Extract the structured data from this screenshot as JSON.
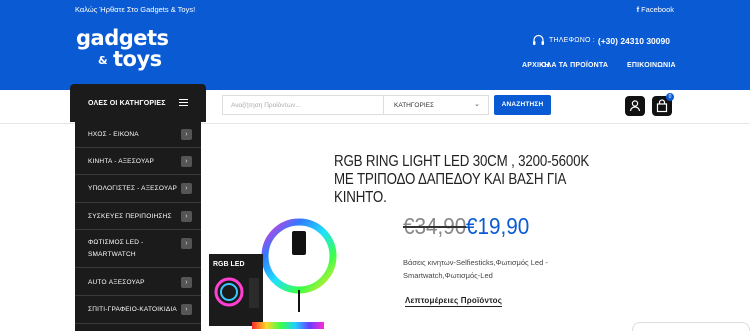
{
  "topbar": {
    "welcome": "Καλώς Ήρθατε Στο Gadgets & Toys!",
    "facebook": "Facebook",
    "facebook_icon": "facebook-icon"
  },
  "logo": {
    "line1": "gadgets",
    "amp": "&",
    "line2": "toys"
  },
  "contact": {
    "icon": "headset-icon",
    "label": "ΤΗΛΕΦΩΝΟ :",
    "phone": "(+30) 24310 30090"
  },
  "nav": [
    "ΑΡΧΙΚΗ",
    "ΟΛΑ ΤΑ ΠΡΟΪΟΝΤΑ",
    "ΕΠΙΚΟΙΝΩΝΙΑ"
  ],
  "categories_menu": {
    "title": "ΟΛΕΣ ΟΙ ΚΑΤΗΓΟΡΙΕΣ",
    "icon": "menu-icon"
  },
  "search": {
    "placeholder": "Αναζήτηση Προϊόντων...",
    "category": "ΚΑΤΗΓΟΡΙΕΣ",
    "button": "ΑΝΑΖΗΤΗΣΗ"
  },
  "cart": {
    "count": "0",
    "account_icon": "user-icon",
    "cart_icon": "shopping-bag-icon"
  },
  "sidebar": [
    {
      "label": "ΗΧΟΣ - ΕΙΚΟΝΑ"
    },
    {
      "label": "ΚΙΝΗΤΑ - ΑΞΕΣΟΥΑΡ"
    },
    {
      "label": "ΥΠΟΛΟΓΙΣΤΕΣ - ΑΞΕΣΟΥΑΡ"
    },
    {
      "label": "ΣΥΣΚΕΥΕΣ ΠΕΡΙΠΟΙΗΣΗΣ"
    },
    {
      "label": "ΦΩΤΙΣΜΟΣ LED -",
      "label2": "SMARTWATCH"
    },
    {
      "label": "AUTO ΑΞΕΣΟΥΑΡ"
    },
    {
      "label": "ΣΠΙΤΙ-ΓΡΑΦΕΙΟ-ΚΑΤΟΙΚΙΔΙΑ"
    }
  ],
  "product": {
    "title": "RGB RING LIGHT LED 30CM , 3200-5600K ΜΕ ΤΡΙΠΟΔΟ ΔΑΠΕΔΟΥ ΚΑΙ ΒΑΣΗ ΓΙΑ ΚΙΝΗΤΟ.",
    "old_price": "€34,90",
    "new_price": "€19,90",
    "categories": "Βάσεις κινητων-Selfiesticks,Φωτισμός Led - Smartwatch,Φωτισμός-Led",
    "more_link": "Λεπτομέρειες Προϊόντος",
    "box_label": "RGB LED"
  },
  "colors": {
    "primary": "#0a5bd3",
    "dark": "#1b1b1b"
  }
}
